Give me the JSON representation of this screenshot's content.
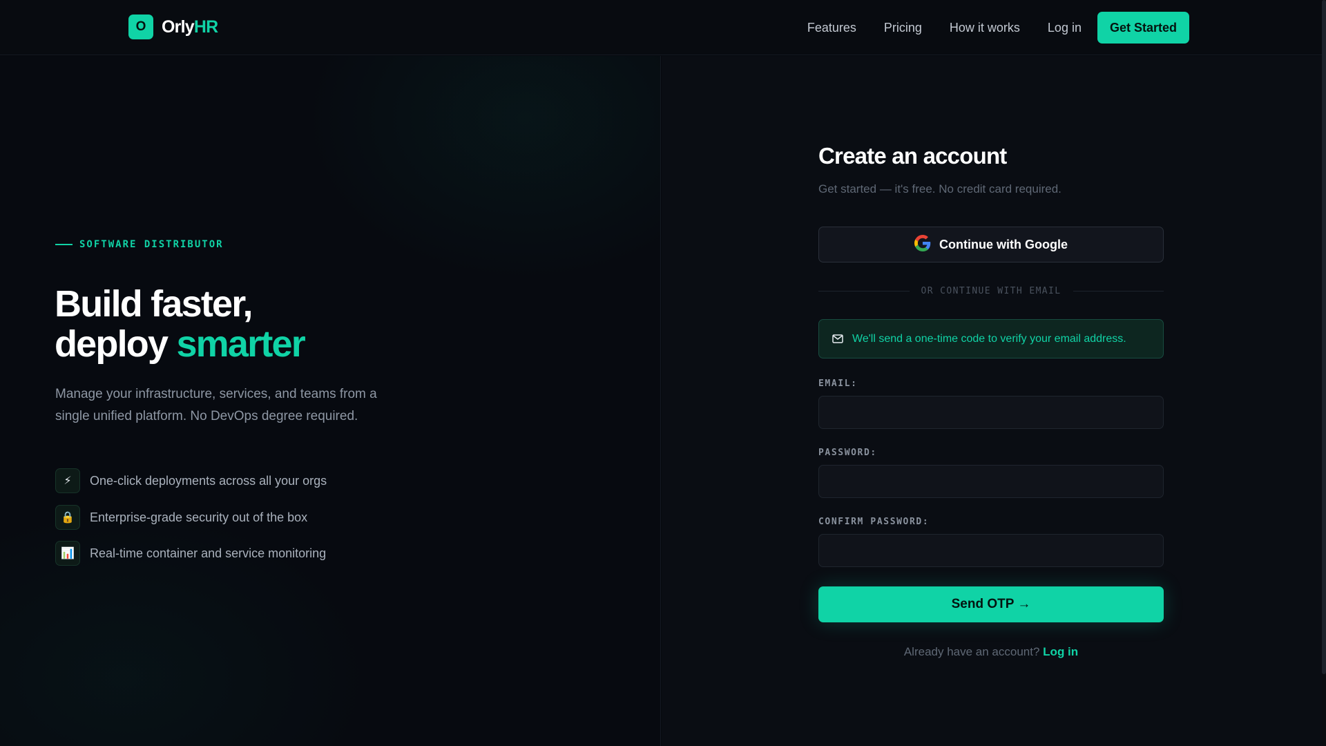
{
  "brand": {
    "mark": "O",
    "name_primary": "Orly",
    "name_accent": "HR",
    "accent_color": "#10d3a6",
    "background_color": "#06080d"
  },
  "nav": {
    "links": [
      "Features",
      "Pricing",
      "How it works",
      "Log in"
    ],
    "cta": "Get Started"
  },
  "hero": {
    "eyebrow": "SOFTWARE DISTRIBUTOR",
    "headline_line1": "Build faster,",
    "headline_line2_plain": "deploy ",
    "headline_line2_accent": "smarter",
    "subtext": "Manage your infrastructure, services, and teams from a single unified platform. No DevOps degree required.",
    "features": [
      {
        "icon": "lightning-icon",
        "glyph": "⚡",
        "text": "One-click deployments across all your orgs"
      },
      {
        "icon": "lock-icon",
        "glyph": "🔒",
        "text": "Enterprise-grade security out of the box"
      },
      {
        "icon": "chart-icon",
        "glyph": "📊",
        "text": "Real-time container and service monitoring"
      }
    ]
  },
  "form": {
    "title": "Create an account",
    "subtitle": "Get started — it's free. No credit card required.",
    "google_button": "Continue with Google",
    "divider": "OR CONTINUE WITH EMAIL",
    "notice": "We'll send a one-time code to verify your email address.",
    "fields": {
      "email": {
        "label": "EMAIL:",
        "value": "",
        "placeholder": ""
      },
      "password": {
        "label": "PASSWORD:",
        "value": "",
        "placeholder": ""
      },
      "confirm_password": {
        "label": "CONFIRM PASSWORD:",
        "value": "",
        "placeholder": ""
      }
    },
    "submit": "Send OTP →",
    "login_prompt": "Already have an account?",
    "login_link": "Log in"
  }
}
